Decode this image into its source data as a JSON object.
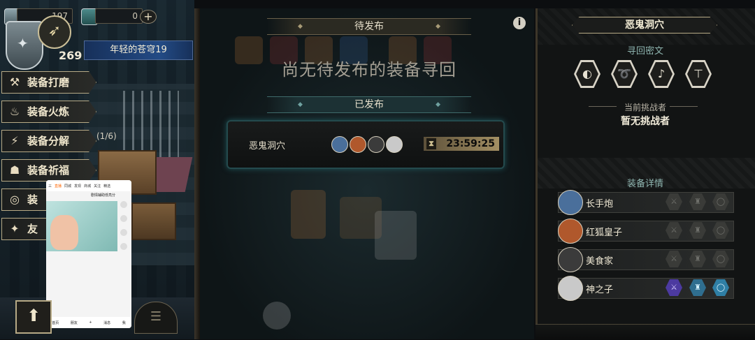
{
  "resources": {
    "res1_value": "197",
    "res2_value": "0"
  },
  "player": {
    "level": "269",
    "title": "年轻的苍穹19"
  },
  "menu": [
    {
      "label": "装备打磨",
      "icon": "hammer-icon"
    },
    {
      "label": "装备火炼",
      "icon": "flame-icon"
    },
    {
      "label": "装备分解",
      "icon": "disassemble-icon"
    },
    {
      "label": "装备祈福",
      "icon": "prayer-icon"
    },
    {
      "label": "装",
      "icon": "target-icon"
    },
    {
      "label": "友",
      "icon": "fox-icon"
    }
  ],
  "menu_count": "(1/6)",
  "pending": {
    "header": "待发布",
    "empty_text": "尚无待发布的装备寻回"
  },
  "published": {
    "header": "已发布",
    "quest": {
      "name": "恶鬼洞穴",
      "timer": "23:59:25",
      "avatars": [
        "长手炮",
        "红狐皇子",
        "美食家",
        "神之子"
      ]
    }
  },
  "details": {
    "location": "恶鬼洞穴",
    "cipher_label": "寻回密文",
    "runes": [
      "rune-1",
      "rune-2",
      "rune-3",
      "rune-4"
    ],
    "challenger_label": "当前挑战者",
    "challenger_value": "暂无挑战者",
    "equipment_label": "装备详情",
    "heroes": [
      {
        "name": "长手炮",
        "slots_active": false
      },
      {
        "name": "红狐皇子",
        "slots_active": false
      },
      {
        "name": "美食家",
        "slots_active": false
      },
      {
        "name": "神之子",
        "slots_active": true
      }
    ]
  },
  "phone_overlay": {
    "nav": [
      "三",
      "直播",
      "同城",
      "发现",
      "商城",
      "关注",
      "精选"
    ],
    "caption": "剧情辅助低亮分",
    "bottom_nav": [
      "首页",
      "朋友",
      "+",
      "消息",
      "我"
    ]
  },
  "colors": {
    "accent_gold": "#b7aa86",
    "teal": "#3f6b6b",
    "timer_bar": "#a38f63"
  }
}
